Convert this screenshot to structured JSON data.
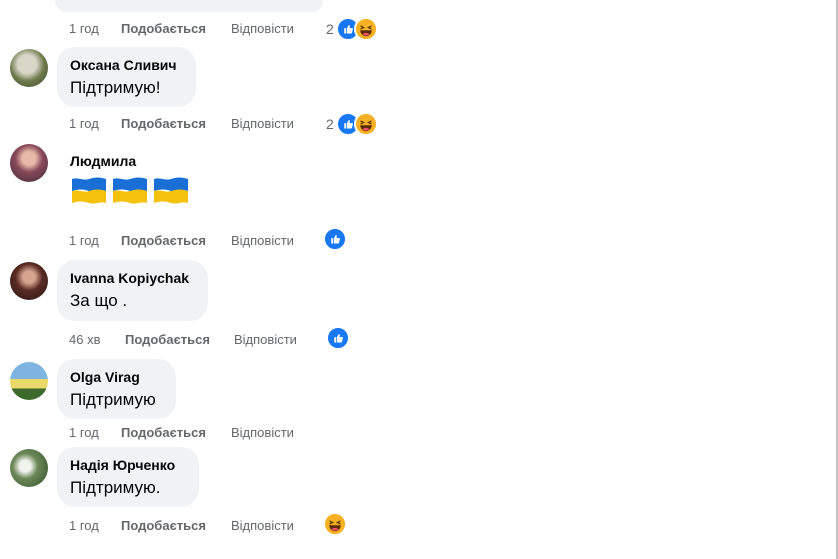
{
  "colors": {
    "like_blue": "#1877f2",
    "haha_yellow": "#f7b125",
    "bubble_bg": "#f0f2f5",
    "meta_gray": "#65676b"
  },
  "top_comment": {
    "time": "1 год",
    "like_label": "Подобається",
    "reply_label": "Відповісти",
    "reaction_count": "2",
    "reactions": [
      "like-icon",
      "haha-icon"
    ]
  },
  "comments": [
    {
      "author": "Оксана Сливич",
      "text": "Підтримую!",
      "time": "1 год",
      "like_label": "Подобається",
      "reply_label": "Відповісти",
      "reaction_count": "2",
      "reactions": [
        "like-icon",
        "haha-icon"
      ]
    },
    {
      "author": "Людмила",
      "emoji": [
        "ukraine-flag-icon",
        "ukraine-flag-icon",
        "ukraine-flag-icon"
      ],
      "time": "1 год",
      "like_label": "Подобається",
      "reply_label": "Відповісти",
      "reactions": [
        "like-icon"
      ]
    },
    {
      "author": "Ivanna Kopiychak",
      "text": "За що .",
      "time": "46 хв",
      "like_label": "Подобається",
      "reply_label": "Відповісти",
      "reactions": [
        "like-icon"
      ]
    },
    {
      "author": "Olga Virag",
      "text": "Підтримую",
      "time": "1 год",
      "like_label": "Подобається",
      "reply_label": "Відповісти",
      "reactions": []
    },
    {
      "author": "Надія Юрченко",
      "text": "Підтримую.",
      "time": "1 год",
      "like_label": "Подобається",
      "reply_label": "Відповісти",
      "reactions": [
        "haha-icon"
      ]
    }
  ]
}
